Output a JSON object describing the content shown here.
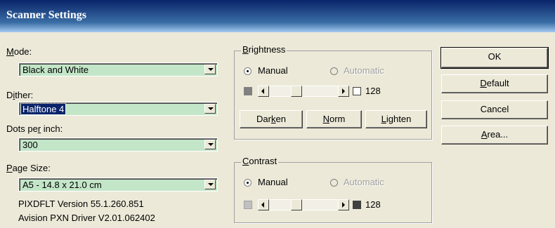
{
  "window": {
    "title": "Scanner Settings"
  },
  "mode": {
    "label_prefix": "",
    "label_key": "M",
    "label_rest": "ode:",
    "value": "Black and White"
  },
  "dither": {
    "label_prefix": "D",
    "label_key": "i",
    "label_rest": "ther:",
    "value": "Halftone 4"
  },
  "dpi": {
    "label_prefix": "Dots pe",
    "label_key": "r",
    "label_rest": " inch:",
    "value": "300"
  },
  "page_size": {
    "label_prefix": "",
    "label_key": "P",
    "label_rest": "age Size:",
    "value": "A5 - 14.8 x 21.0 cm"
  },
  "info": {
    "version": "PIXDFLT Version 55.1.260.851",
    "driver": "Avision PXN Driver V2.01.062402"
  },
  "brightness": {
    "title_key": "B",
    "title_rest": "rightness",
    "manual": "Manual",
    "automatic": "Automatic",
    "value": "128",
    "swatch_left": "#808080",
    "swatch_right": "#FFFFFF",
    "darken_pre": "Dar",
    "darken_key": "k",
    "darken_post": "en",
    "norm_pre": "",
    "norm_key": "N",
    "norm_post": "orm",
    "lighten_pre": "",
    "lighten_key": "L",
    "lighten_post": "ighten"
  },
  "contrast": {
    "title_key": "C",
    "title_rest": "ontrast",
    "manual": "Manual",
    "automatic": "Automatic",
    "value": "128",
    "swatch_left": "#C0C0C0",
    "swatch_right": "#404040"
  },
  "buttons": {
    "ok": "OK",
    "default_key": "D",
    "default_rest": "efault",
    "cancel": "Cancel",
    "area_key": "A",
    "area_rest": "rea..."
  },
  "colors": {
    "titlebar": "#0A246A",
    "field_bg": "#C3E6C8",
    "dialog_bg": "#ECE9D8"
  }
}
